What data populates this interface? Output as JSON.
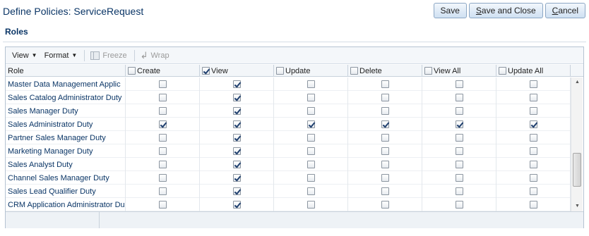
{
  "page": {
    "title": "Define Policies: ServiceRequest"
  },
  "actions": {
    "save": "Save",
    "save_close_pre": "S",
    "save_close_rest": "ave and Close",
    "cancel_pre": "C",
    "cancel_rest": "ancel"
  },
  "section": {
    "title": "Roles"
  },
  "toolbar": {
    "view": "View",
    "format": "Format",
    "freeze": "Freeze",
    "wrap": "Wrap"
  },
  "columns": [
    {
      "label": "Role"
    },
    {
      "label": "Create",
      "checked": false
    },
    {
      "label": "View",
      "checked": true
    },
    {
      "label": "Update",
      "checked": false
    },
    {
      "label": "Delete",
      "checked": false
    },
    {
      "label": "View All",
      "checked": false
    },
    {
      "label": "Update All",
      "checked": false
    }
  ],
  "rows": [
    {
      "role": "Master Data Management Applic",
      "perms": [
        false,
        true,
        false,
        false,
        false,
        false
      ]
    },
    {
      "role": "Sales Catalog Administrator Duty",
      "perms": [
        false,
        true,
        false,
        false,
        false,
        false
      ]
    },
    {
      "role": "Sales Manager Duty",
      "perms": [
        false,
        true,
        false,
        false,
        false,
        false
      ]
    },
    {
      "role": "Sales Administrator Duty",
      "perms": [
        true,
        true,
        true,
        true,
        true,
        true
      ]
    },
    {
      "role": "Partner Sales Manager Duty",
      "perms": [
        false,
        true,
        false,
        false,
        false,
        false
      ]
    },
    {
      "role": "Marketing Manager Duty",
      "perms": [
        false,
        true,
        false,
        false,
        false,
        false
      ]
    },
    {
      "role": "Sales Analyst Duty",
      "perms": [
        false,
        true,
        false,
        false,
        false,
        false
      ]
    },
    {
      "role": "Channel Sales Manager Duty",
      "perms": [
        false,
        true,
        false,
        false,
        false,
        false
      ]
    },
    {
      "role": "Sales Lead Qualifier Duty",
      "perms": [
        false,
        true,
        false,
        false,
        false,
        false
      ]
    },
    {
      "role": "CRM Application Administrator Du",
      "perms": [
        false,
        true,
        false,
        false,
        false,
        false
      ]
    }
  ]
}
